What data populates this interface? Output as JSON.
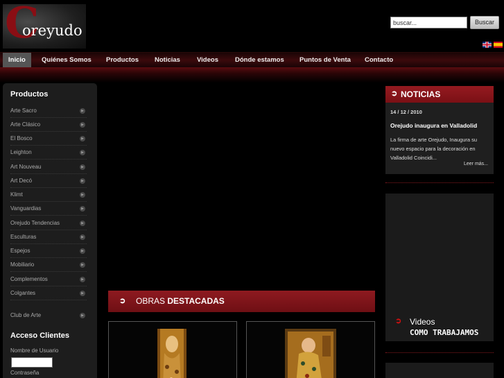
{
  "header": {
    "logo_text": "oreyudo",
    "search_placeholder": "buscar...",
    "search_button": "Buscar",
    "languages": [
      "en-flag",
      "es-flag"
    ]
  },
  "nav": {
    "items": [
      "Inicio",
      "Quiénes Somos",
      "Productos",
      "Noticias",
      "Videos",
      "Dónde estamos",
      "Puntos de Venta",
      "Contacto"
    ],
    "active": "Inicio"
  },
  "sidebar": {
    "title": "Productos",
    "items": [
      "Arte Sacro",
      "Arte Clásico",
      "El Bosco",
      "Leighton",
      "Art Nouveau",
      "Art Decó",
      "Klimt",
      "Vanguardias",
      "Orejudo Tendencias",
      "Esculturas",
      "Espejos",
      "Mobiliario",
      "Complementos",
      "Colgantes",
      "Club de Arte"
    ],
    "access_title": "Acceso Clientes",
    "user_label": "Nombre de Usuario",
    "password_label": "Contraseña"
  },
  "main": {
    "obras_prefix": "OBRAS",
    "obras_suffix": "DESTACADAS"
  },
  "noticias": {
    "title": "NOTICIAS",
    "date": "14 / 12 / 2010",
    "headline": "Orejudo inaugura en Valladolid",
    "body": "La firma de arte Orejudo, Inaugura su nuevo espacio para la decoración en Valladolid Coincidi...",
    "more": "Leer más..."
  },
  "videos": {
    "title": "Videos",
    "subtitle": "COMO TRABAJAMOS"
  },
  "colors": {
    "accent": "#8e1a20",
    "nav_bg": "#3b0a0c",
    "sidebar_bg": "#1d1d1d"
  }
}
